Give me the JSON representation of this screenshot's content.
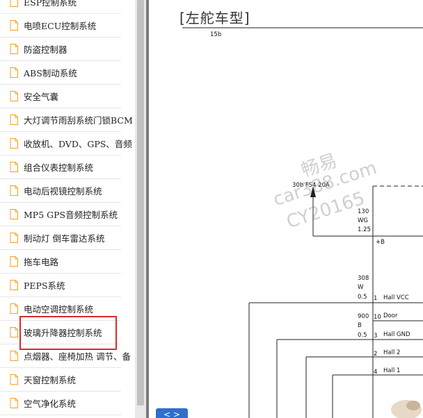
{
  "sidebar": {
    "items": [
      {
        "label": "ESP控制系统"
      },
      {
        "label": "电喷ECU控制系统"
      },
      {
        "label": "防盗控制器"
      },
      {
        "label": "ABS制动系统"
      },
      {
        "label": "安全气囊"
      },
      {
        "label": "大灯调节雨刮系统门锁BCM"
      },
      {
        "label": "收放机、DVD、GPS、音频"
      },
      {
        "label": "组合仪表控制系统"
      },
      {
        "label": "电动后视镜控制系统"
      },
      {
        "label": "MP5 GPS音频控制系统"
      },
      {
        "label": "制动灯 倒车雷达系统"
      },
      {
        "label": "拖车电路"
      },
      {
        "label": "PEPS系统"
      },
      {
        "label": "电动空调控制系统"
      },
      {
        "label": "玻璃升降器控制系统"
      },
      {
        "label": "点烟器、座椅加热 调节、备"
      },
      {
        "label": "天窗控制系统"
      },
      {
        "label": "空气净化系统"
      }
    ],
    "highlight_color": "#d62b2b"
  },
  "diagram": {
    "title": "[左舵车型]",
    "labels": {
      "bus": "15b",
      "fuse": "30b FS4 20A",
      "w1a": "130",
      "w1b": "WG",
      "w1c": "1.25",
      "plusb": "+B",
      "w2a": "308",
      "w2b": "W",
      "w2c": "0.5",
      "pin1": "1",
      "hall_vcc": "Hall VCC",
      "w3a": "900",
      "w3b": "B",
      "w3c": "0.5",
      "pin10": "10",
      "door": "Door",
      "pin3": "3",
      "hall_gnd": "Hall GND",
      "pin2": "2",
      "hall2": "Hall 2",
      "pin4": "4",
      "hall1": "Hall 1"
    },
    "watermark": {
      "line1": "畅易",
      "line2": "car388.com",
      "line3": "CY20165"
    },
    "nav_button": "< >"
  }
}
